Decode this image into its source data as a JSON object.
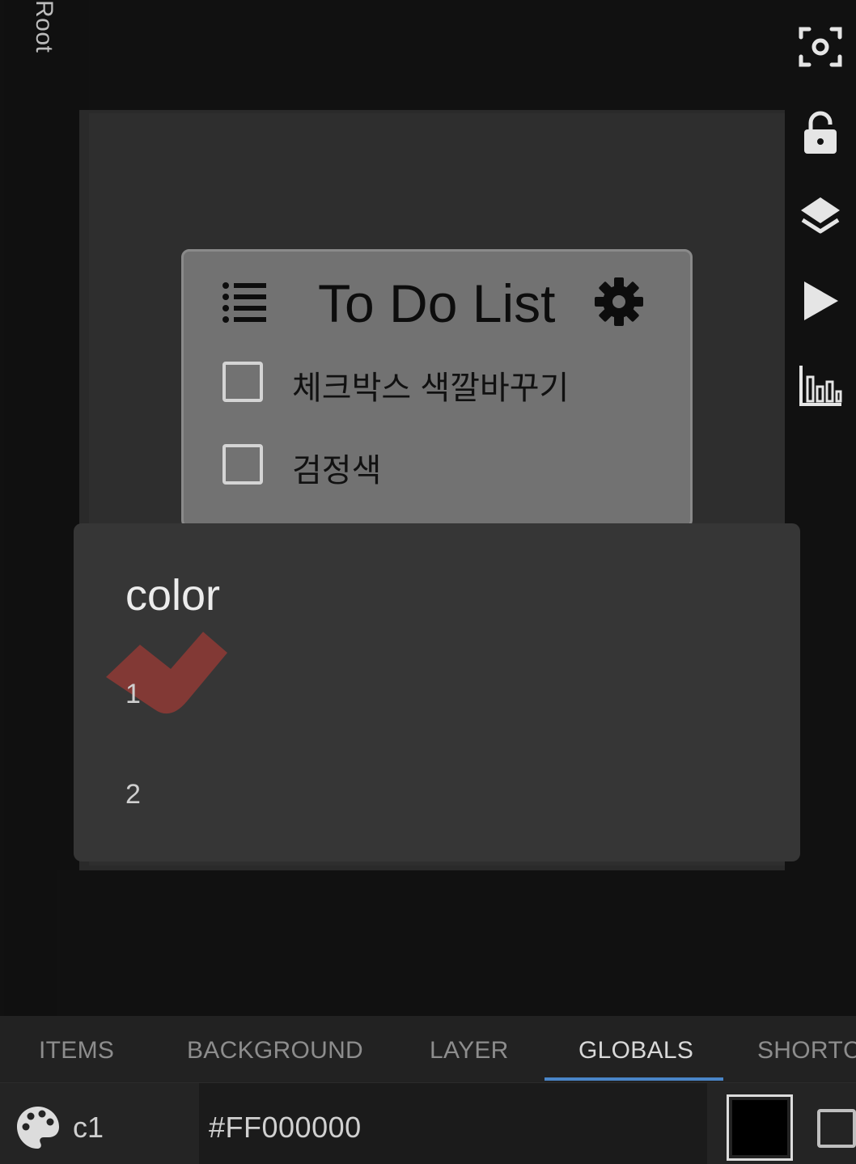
{
  "root_label": "Root",
  "todo": {
    "title": "To Do List",
    "items": [
      {
        "label": "체크박스 색깔바꾸기",
        "checked": false
      },
      {
        "label": "검정색",
        "checked": false
      }
    ]
  },
  "color_dialog": {
    "title": "color",
    "options": [
      "1",
      "2"
    ],
    "ripple_color": "#8b3a35"
  },
  "toolbar": {
    "icons": [
      "capture-icon",
      "lock-open-icon",
      "layers-icon",
      "play-icon",
      "chart-icon"
    ]
  },
  "tabs": {
    "items": [
      "ITEMS",
      "BACKGROUND",
      "LAYER",
      "GLOBALS",
      "SHORTC"
    ],
    "active": "GLOBALS"
  },
  "globals": {
    "var_name": "c1",
    "value": "#FF000000",
    "swatch_color": "#000000"
  },
  "colors": {
    "accent": "#4a86c8",
    "card": "#727272",
    "dialog": "#363636"
  }
}
